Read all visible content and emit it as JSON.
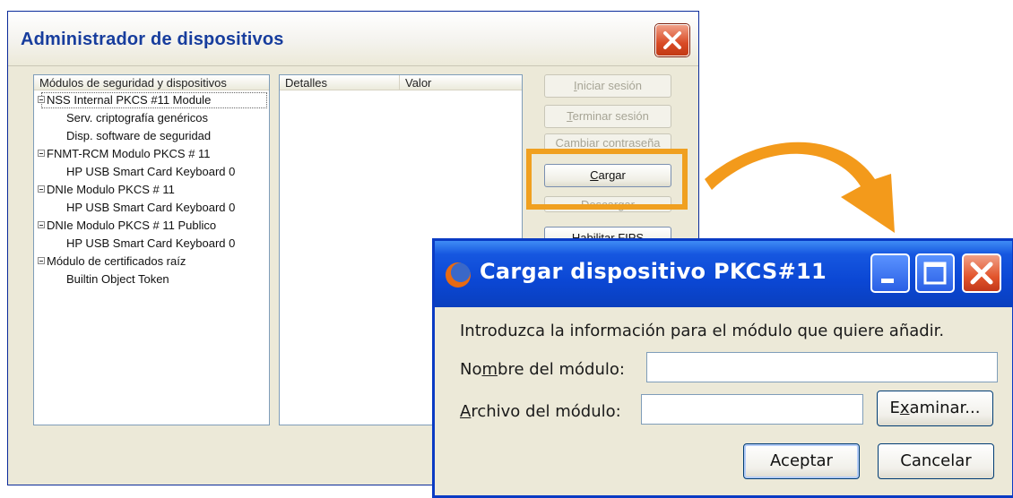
{
  "main_window": {
    "title": "Administrador de dispositivos",
    "modules_header": "Módulos de seguridad y dispositivos",
    "details_header": "Detalles",
    "value_header": "Valor",
    "tree": [
      {
        "label": "NSS Internal PKCS #11 Module",
        "children": [
          "Serv. criptografía genéricos",
          "Disp. software de seguridad"
        ]
      },
      {
        "label": "FNMT-RCM Modulo PKCS # 11",
        "children": [
          "HP USB Smart Card Keyboard 0"
        ]
      },
      {
        "label": "DNIe Modulo PKCS # 11",
        "children": [
          "HP USB Smart Card Keyboard 0"
        ]
      },
      {
        "label": "DNIe Modulo PKCS # 11 Publico",
        "children": [
          "HP USB Smart Card Keyboard 0"
        ]
      },
      {
        "label": "Módulo de certificados raíz",
        "children": [
          "Builtin Object Token"
        ]
      }
    ],
    "buttons": {
      "login": {
        "pre": "",
        "u": "I",
        "post": "niciar sesión"
      },
      "logout": {
        "pre": "",
        "u": "T",
        "post": "erminar sesión"
      },
      "change_password": {
        "label": "Cambiar contraseña"
      },
      "load": {
        "pre": "",
        "u": "C",
        "post": "argar"
      },
      "unload": {
        "label": "Descargar"
      },
      "fips": {
        "pre": "Habilitar ",
        "u": "F",
        "post": "IPS"
      }
    }
  },
  "dialog": {
    "title": "Cargar dispositivo PKCS#11",
    "instruction": "Introduzca la información para el módulo que quiere añadir.",
    "name_label": {
      "pre": "No",
      "u": "m",
      "post": "bre del módulo:"
    },
    "name_value": "",
    "file_label": {
      "pre": "",
      "u": "A",
      "post": "rchivo del módulo:"
    },
    "file_value": "",
    "browse": {
      "pre": "E",
      "u": "x",
      "post": "aminar..."
    },
    "accept": "Aceptar",
    "cancel": "Cancelar"
  },
  "colors": {
    "highlight": "#f0a020",
    "arrow": "#f39a1b",
    "xp_blue": "#0a47d4",
    "close_red": "#e2552c"
  }
}
